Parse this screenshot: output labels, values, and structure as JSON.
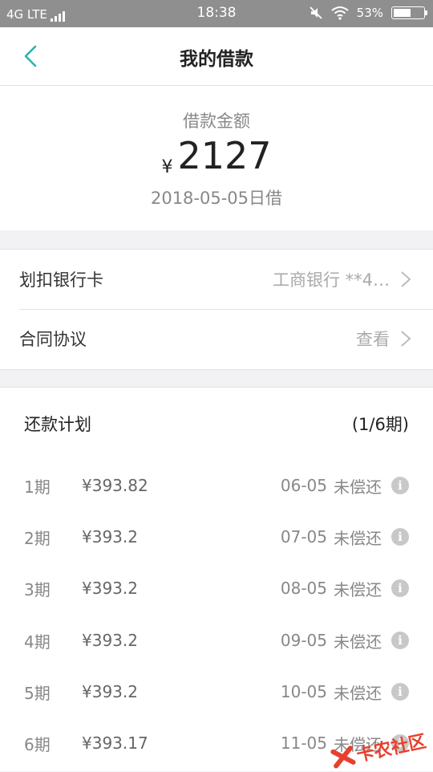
{
  "status_bar": {
    "network": "4G LTE",
    "time": "18:38",
    "battery": "53%",
    "battery_level": 0.53
  },
  "nav": {
    "title": "我的借款",
    "back_icon": "chevron-left-icon"
  },
  "loan": {
    "amount_label": "借款金额",
    "currency": "¥",
    "amount": "2127",
    "date": "2018-05-05日借"
  },
  "info_rows": [
    {
      "label": "划扣银行卡",
      "value": "工商银行 **4…"
    },
    {
      "label": "合同协议",
      "value": "查看"
    }
  ],
  "plan": {
    "title": "还款计划",
    "progress": "(1/6期)",
    "rows": [
      {
        "period": "1期",
        "amount": "¥393.82",
        "date": "06-05",
        "status": "未偿还"
      },
      {
        "period": "2期",
        "amount": "¥393.2",
        "date": "07-05",
        "status": "未偿还"
      },
      {
        "period": "3期",
        "amount": "¥393.2",
        "date": "08-05",
        "status": "未偿还"
      },
      {
        "period": "4期",
        "amount": "¥393.2",
        "date": "09-05",
        "status": "未偿还"
      },
      {
        "period": "5期",
        "amount": "¥393.2",
        "date": "10-05",
        "status": "未偿还"
      },
      {
        "period": "6期",
        "amount": "¥393.17",
        "date": "11-05",
        "status": "未偿还"
      }
    ]
  },
  "watermark": {
    "text": "卡农社区"
  },
  "colors": {
    "accent": "#2bb3b1",
    "status_bar": "#8f8f8f",
    "watermark": "#e8402e"
  }
}
